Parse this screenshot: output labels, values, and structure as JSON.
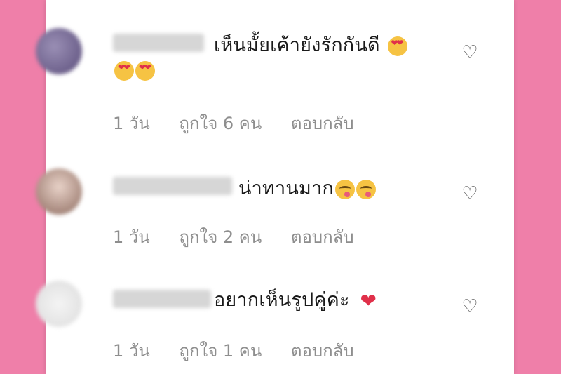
{
  "colors": {
    "background": "#ef7fa9",
    "panel": "#ffffff",
    "meta_text": "#8e8e8e",
    "heart": "#e0304a"
  },
  "comments": [
    {
      "text": "เห็นมั้ยเค้ายังรักกันดี",
      "emojis": [
        "smiling-face-with-heart-eyes",
        "smiling-face-with-heart-eyes",
        "smiling-face-with-heart-eyes"
      ],
      "time": "1 วัน",
      "likes": "ถูกใจ 6 คน",
      "reply": "ตอบกลับ"
    },
    {
      "text": "น่าทานมาก",
      "emojis": [
        "face-savoring-food",
        "face-savoring-food"
      ],
      "time": "1 วัน",
      "likes": "ถูกใจ 2 คน",
      "reply": "ตอบกลับ"
    },
    {
      "text": "อยากเห็นรูปคู่ค่ะ",
      "emojis": [
        "red-heart"
      ],
      "time": "1 วัน",
      "likes": "ถูกใจ 1 คน",
      "reply": "ตอบกลับ"
    }
  ],
  "icons": {
    "like": "heart-outline-icon"
  }
}
